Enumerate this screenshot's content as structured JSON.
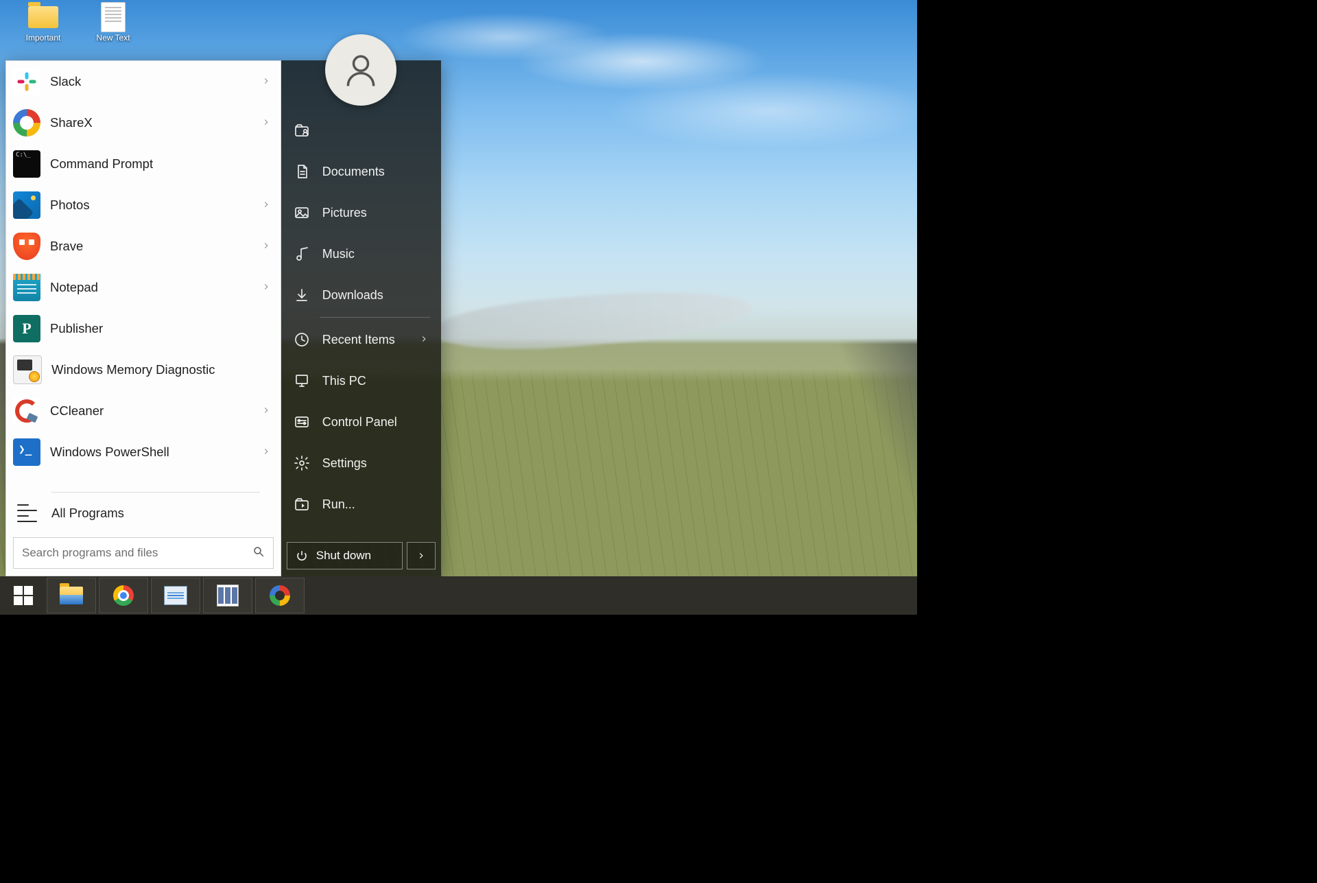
{
  "desktop": {
    "icons": [
      {
        "label": "Important",
        "type": "folder"
      },
      {
        "label": "New Text",
        "type": "textfile"
      }
    ]
  },
  "start_menu": {
    "apps": [
      {
        "label": "Slack",
        "icon": "slack-icon",
        "has_submenu": true
      },
      {
        "label": "ShareX",
        "icon": "sharex-icon",
        "has_submenu": true
      },
      {
        "label": "Command Prompt",
        "icon": "command-prompt-icon",
        "has_submenu": false
      },
      {
        "label": "Photos",
        "icon": "photos-icon",
        "has_submenu": true
      },
      {
        "label": "Brave",
        "icon": "brave-icon",
        "has_submenu": true
      },
      {
        "label": "Notepad",
        "icon": "notepad-icon",
        "has_submenu": true
      },
      {
        "label": "Publisher",
        "icon": "publisher-icon",
        "has_submenu": false
      },
      {
        "label": "Windows Memory Diagnostic",
        "icon": "memory-diagnostic-icon",
        "has_submenu": false
      },
      {
        "label": "CCleaner",
        "icon": "ccleaner-icon",
        "has_submenu": true
      },
      {
        "label": "Windows PowerShell",
        "icon": "powershell-icon",
        "has_submenu": true
      }
    ],
    "all_programs_label": "All Programs",
    "search_placeholder": "Search programs and files",
    "right_panel": {
      "items": [
        {
          "label": "",
          "icon": "user-folder-icon",
          "has_submenu": false
        },
        {
          "label": "Documents",
          "icon": "document-icon",
          "has_submenu": false
        },
        {
          "label": "Pictures",
          "icon": "picture-icon",
          "has_submenu": false
        },
        {
          "label": "Music",
          "icon": "music-icon",
          "has_submenu": false
        },
        {
          "label": "Downloads",
          "icon": "download-icon",
          "has_submenu": false
        },
        {
          "label": "Recent Items",
          "icon": "recent-icon",
          "has_submenu": true
        },
        {
          "label": "This PC",
          "icon": "this-pc-icon",
          "has_submenu": false
        },
        {
          "label": "Control Panel",
          "icon": "control-panel-icon",
          "has_submenu": false
        },
        {
          "label": "Settings",
          "icon": "settings-icon",
          "has_submenu": false
        },
        {
          "label": "Run...",
          "icon": "run-icon",
          "has_submenu": false
        }
      ]
    },
    "shutdown_label": "Shut down"
  },
  "taskbar": {
    "buttons": [
      {
        "name": "start-button",
        "icon": "windows-logo-icon"
      },
      {
        "name": "file-explorer-button",
        "icon": "file-explorer-icon"
      },
      {
        "name": "chrome-button",
        "icon": "chrome-icon"
      },
      {
        "name": "task-manager-button",
        "icon": "task-manager-icon"
      },
      {
        "name": "open-shell-button",
        "icon": "open-shell-icon"
      },
      {
        "name": "sharex-button",
        "icon": "sharex-icon"
      }
    ]
  }
}
